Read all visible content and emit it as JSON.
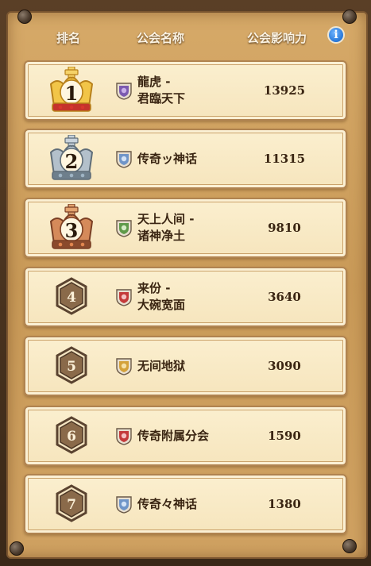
{
  "header": {
    "rank_label": "排名",
    "guild_name_label": "公会名称",
    "influence_label": "公会影响力",
    "info_icon": "info-icon"
  },
  "colors": {
    "gold_crown": "#e8b53a",
    "silver_crown": "#9aa8b4",
    "bronze_crown": "#c07a4e",
    "hex_badge": "#8a6a4a",
    "text": "#3a2512"
  },
  "rows": [
    {
      "rank": "1",
      "badge": "gold-crown",
      "emblem": "purple-cat-emblem",
      "name": "龍虎 -\n君臨天下",
      "score": "13925"
    },
    {
      "rank": "2",
      "badge": "silver-crown",
      "emblem": "blue-wolf-emblem",
      "name": "传奇ッ神话",
      "score": "11315"
    },
    {
      "rank": "3",
      "badge": "bronze-crown",
      "emblem": "green-dragon-emblem",
      "name": "天上人间 -\n诸神净土",
      "score": "9810"
    },
    {
      "rank": "4",
      "badge": "hex",
      "emblem": "red-cat-emblem",
      "name": "来份 -\n大碗宽面",
      "score": "3640"
    },
    {
      "rank": "5",
      "badge": "hex",
      "emblem": "gold-lion-emblem",
      "name": "无间地狱",
      "score": "3090"
    },
    {
      "rank": "6",
      "badge": "hex",
      "emblem": "red-cat-emblem",
      "name": "传奇附属分会",
      "score": "1590"
    },
    {
      "rank": "7",
      "badge": "hex",
      "emblem": "blue-wolf-emblem",
      "name": "传奇々神话",
      "score": "1380"
    }
  ]
}
